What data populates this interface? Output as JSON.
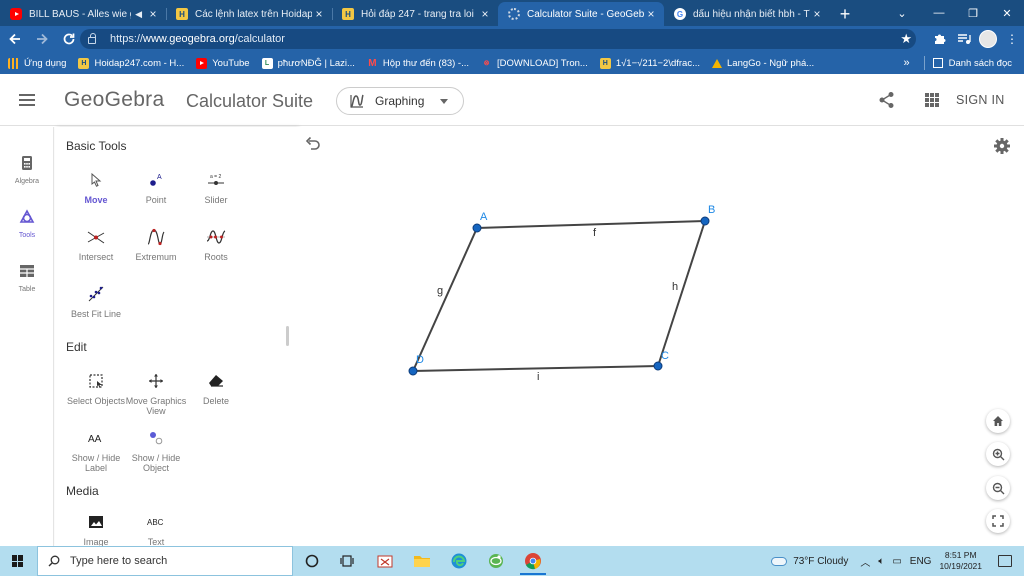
{
  "browser": {
    "tabs": [
      {
        "title": "BILL BAUS - Alles wie ge",
        "favicon": "youtube",
        "extra": "◀",
        "active": false
      },
      {
        "title": "Các lệnh latex trên Hoidap24",
        "favicon": "hoidap",
        "active": false
      },
      {
        "title": "Hỏi đáp 247 - trang tra loi",
        "favicon": "hoidap",
        "active": false
      },
      {
        "title": "Calculator Suite - GeoGebra",
        "favicon": "geogebra",
        "active": true
      },
      {
        "title": "dấu hiệu nhận biết hbh - Tìm",
        "favicon": "google",
        "active": false
      }
    ],
    "tab_close_glyph": "×",
    "new_tab_glyph": "+",
    "window_controls": {
      "tab_search": "⌄",
      "minimize": "—",
      "restore": "❐",
      "close": "✕"
    },
    "url_scheme": "https://",
    "url_host": "www.geogebra.org",
    "url_path": "/calculator",
    "bookmarks": [
      {
        "label": "Ứng dụng",
        "icon": "apps-icon"
      },
      {
        "label": "Hoidap247.com - H...",
        "icon": "hoidap-icon"
      },
      {
        "label": "YouTube",
        "icon": "youtube-icon"
      },
      {
        "label": "pħươNĐĜ | Lazi...",
        "icon": "lazi-icon"
      },
      {
        "label": "Hộp thư đến (83) -...",
        "icon": "gmail-icon"
      },
      {
        "label": "[DOWNLOAD] Tron...",
        "icon": "download-icon"
      },
      {
        "label": "1√1−√211−2\\dfrac...",
        "icon": "hoidap-icon"
      },
      {
        "label": "LangGo - Ngữ phá...",
        "icon": "drive-icon"
      }
    ],
    "bookmarks_more": "»",
    "reading_list": "Danh sách đọc"
  },
  "geogebra": {
    "logo": "GeoGebra",
    "suite_title": "Calculator Suite",
    "app_picker": "Graphing",
    "sign_in": "SIGN IN",
    "rail": [
      {
        "label": "Algebra",
        "icon": "calculator-icon",
        "active": false
      },
      {
        "label": "Tools",
        "icon": "tools-icon",
        "active": true
      },
      {
        "label": "Table",
        "icon": "table-icon",
        "active": false
      }
    ],
    "sections": [
      {
        "title": "Basic Tools",
        "tools": [
          {
            "label": "Move",
            "icon": "cursor-icon",
            "selected": true
          },
          {
            "label": "Point",
            "icon": "point-icon",
            "selected": false
          },
          {
            "label": "Slider",
            "icon": "slider-icon",
            "selected": false
          },
          {
            "label": "Intersect",
            "icon": "intersect-icon",
            "selected": false
          },
          {
            "label": "Extremum",
            "icon": "extremum-icon",
            "selected": false
          },
          {
            "label": "Roots",
            "icon": "roots-icon",
            "selected": false
          },
          {
            "label": "Best Fit Line",
            "icon": "best-fit-icon",
            "selected": false
          }
        ]
      },
      {
        "title": "Edit",
        "tools": [
          {
            "label": "Select Objects",
            "icon": "select-icon",
            "selected": false
          },
          {
            "label": "Move Graphics View",
            "icon": "move-view-icon",
            "selected": false
          },
          {
            "label": "Delete",
            "icon": "eraser-icon",
            "selected": false
          },
          {
            "label": "Show / Hide Label",
            "icon": "label-icon",
            "selected": false
          },
          {
            "label": "Show / Hide Object",
            "icon": "visibility-icon",
            "selected": false
          }
        ]
      },
      {
        "title": "Media",
        "tools": [
          {
            "label": "Image",
            "icon": "image-icon",
            "selected": false
          },
          {
            "label": "Text",
            "icon": "text-icon",
            "selected": false
          }
        ]
      }
    ],
    "slider_icon_text": "a = 2",
    "text_icon_text": "ABC",
    "label_icon_text": "AA",
    "figure": {
      "points": [
        {
          "name": "A"
        },
        {
          "name": "B"
        },
        {
          "name": "C"
        },
        {
          "name": "D"
        }
      ],
      "segments": [
        {
          "name": "f",
          "from": "A",
          "to": "B"
        },
        {
          "name": "h",
          "from": "B",
          "to": "C"
        },
        {
          "name": "i",
          "from": "C",
          "to": "D"
        },
        {
          "name": "g",
          "from": "D",
          "to": "A"
        }
      ],
      "point_color": "#1565c0",
      "point_label_color": "#1e88e5",
      "segment_color": "#444444"
    },
    "accent_color": "#6557d2"
  },
  "taskbar": {
    "search_placeholder": "Type here to search",
    "weather": "73°F  Cloudy",
    "lang": "ENG",
    "time": "8:51 PM",
    "date": "10/19/2021"
  }
}
